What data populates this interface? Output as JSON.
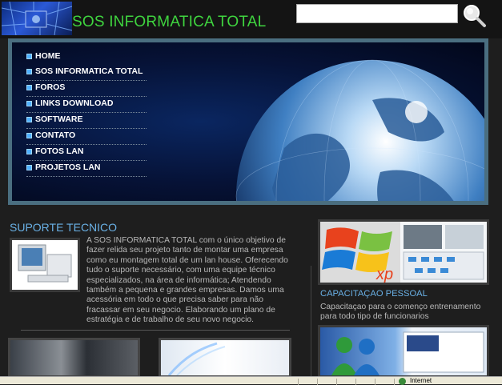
{
  "header": {
    "site_title": "SOS INFORMATICA TOTAL",
    "search_placeholder": ""
  },
  "nav": {
    "items": [
      {
        "label": "HOME"
      },
      {
        "label": "SOS INFORMATICA TOTAL"
      },
      {
        "label": "FOROS"
      },
      {
        "label": "LINKS DOWNLOAD"
      },
      {
        "label": "SOFTWARE"
      },
      {
        "label": "CONTATO"
      },
      {
        "label": "FOTOS LAN"
      },
      {
        "label": "PROJETOS LAN"
      }
    ]
  },
  "suporte": {
    "title": "SUPORTE TECNICO",
    "text": "A SOS INFORMATICA TOTAL com o único objetivo de fazer relida seu projeto tanto de montar uma empresa como eu montagem total de um lan house. Oferecendo tudo o suporte necessário, com uma equipe técnico especializados, na área de informática; Atendendo também a pequena e grandes empresas. Damos uma acessória em todo o que precisa saber para não fracassar em seu negocio. Elaborando um plano de estratégia e de trabalho de seu novo negocio."
  },
  "capacitacao": {
    "title": "CAPACITAÇAO PESSOAL",
    "text": "Capacitaçao para o començo entrenamento para todo tipo de funcionarios",
    "xp_label": "xp"
  },
  "statusbar": {
    "zone_text": "Internet"
  },
  "colors": {
    "title_green": "#3fd43f",
    "section_blue": "#6ab1e6",
    "background": "#1e1e1e"
  }
}
